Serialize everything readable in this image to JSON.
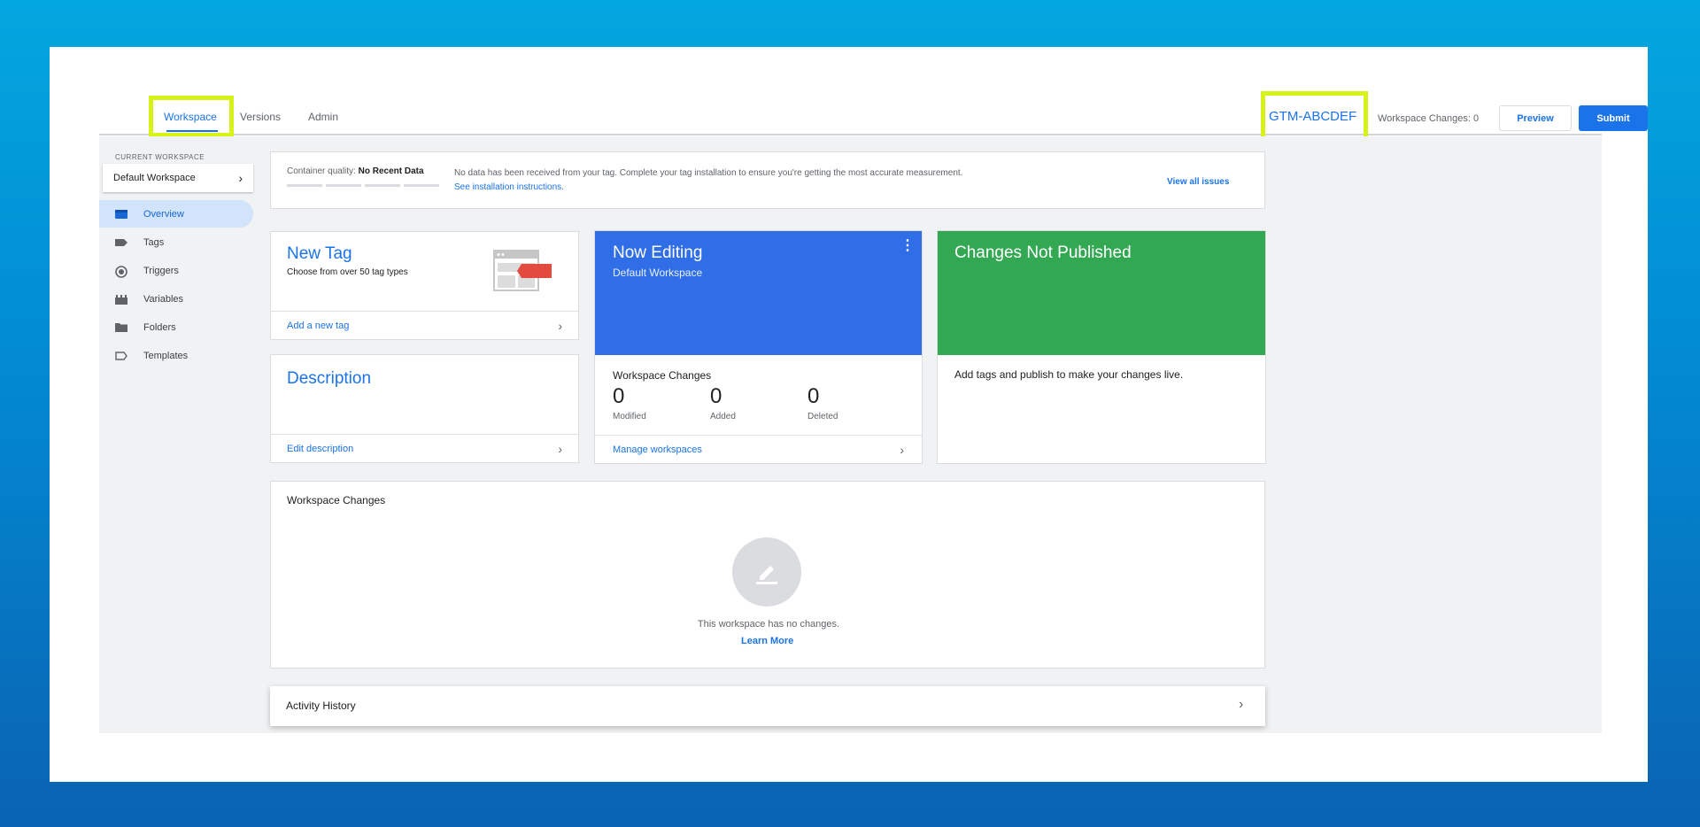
{
  "nav": {
    "tabs": [
      {
        "label": "Workspace"
      },
      {
        "label": "Versions"
      },
      {
        "label": "Admin"
      }
    ],
    "container_id": "GTM-ABCDEF",
    "workspace_changes": "Workspace Changes: 0",
    "preview_label": "Preview",
    "submit_label": "Submit"
  },
  "sidebar": {
    "current_workspace_label": "CURRENT WORKSPACE",
    "current_workspace": "Default Workspace",
    "items": [
      {
        "label": "Overview",
        "icon": "overview-icon"
      },
      {
        "label": "Tags",
        "icon": "tag-icon"
      },
      {
        "label": "Triggers",
        "icon": "trigger-icon"
      },
      {
        "label": "Variables",
        "icon": "variables-icon"
      },
      {
        "label": "Folders",
        "icon": "folder-icon"
      },
      {
        "label": "Templates",
        "icon": "template-icon"
      }
    ]
  },
  "quality": {
    "label": "Container quality:",
    "value": "No Recent Data",
    "message": "No data has been received from your tag. Complete your tag installation to ensure you're getting the most accurate measurement.",
    "link": "See installation instructions.",
    "view_all": "View all issues"
  },
  "new_tag": {
    "title": "New Tag",
    "subtitle": "Choose from over 50 tag types",
    "footer": "Add a new tag"
  },
  "description": {
    "title": "Description",
    "footer": "Edit description"
  },
  "now_editing": {
    "title": "Now Editing",
    "subtitle": "Default Workspace",
    "changes_title": "Workspace Changes",
    "modified": "0",
    "modified_label": "Modified",
    "added": "0",
    "added_label": "Added",
    "deleted": "0",
    "deleted_label": "Deleted",
    "footer": "Manage workspaces"
  },
  "changes_not_published": {
    "title": "Changes Not Published",
    "body": "Add tags and publish to make your changes live."
  },
  "workspace_changes": {
    "title": "Workspace Changes",
    "empty_text": "This workspace has no changes.",
    "learn_more": "Learn More"
  },
  "activity_history": {
    "title": "Activity History"
  },
  "colors": {
    "accent": "#1a73e8",
    "editing_blue": "#2f6ee7",
    "published_green": "#33a853",
    "highlight": "#d7f218"
  }
}
